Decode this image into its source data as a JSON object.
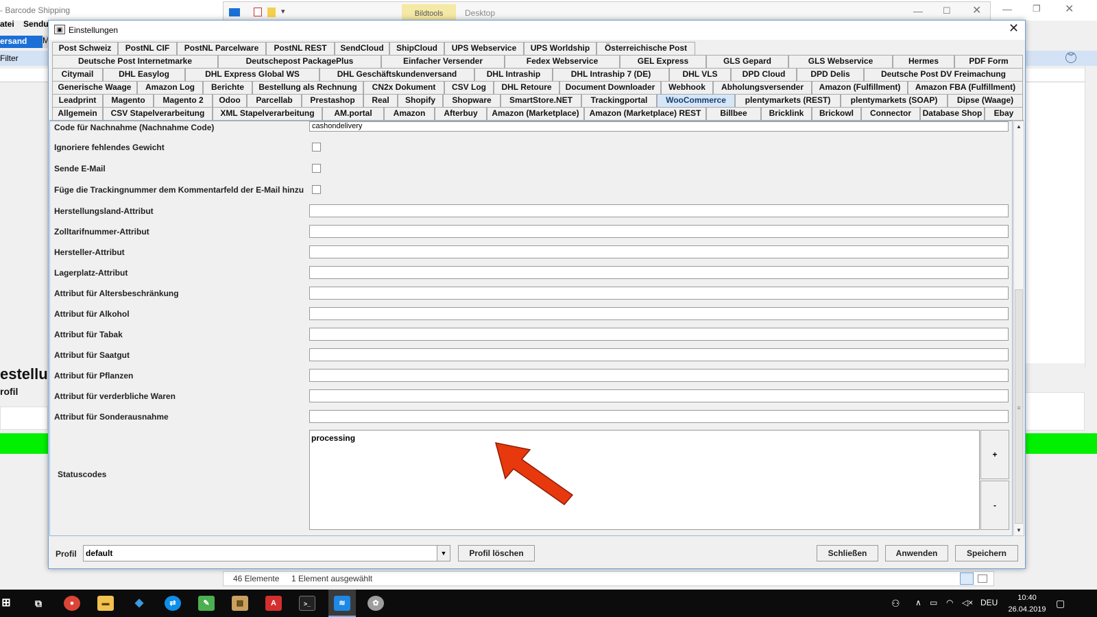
{
  "background_app": {
    "title": "- Barcode Shipping",
    "menu": [
      "atei",
      "Sendu"
    ],
    "active_tab": "ersand",
    "second_tab": "M",
    "filter_label": "Filter",
    "section_title": "estellu",
    "section_sub": "rofil"
  },
  "explorer": {
    "bildtools": "Bildtools",
    "desktop": "Desktop",
    "count": "46 Elemente",
    "selected": "1 Element ausgewählt"
  },
  "dialog": {
    "title": "Einstellungen",
    "tab_rows": [
      [
        "Post Schweiz",
        "PostNL CIF",
        "PostNL Parcelware",
        "PostNL REST",
        "SendCloud",
        "ShipCloud",
        "UPS Webservice",
        "UPS Worldship",
        "Österreichische Post"
      ],
      [
        "Deutsche Post Internetmarke",
        "Deutschepost PackagePlus",
        "Einfacher Versender",
        "Fedex Webservice",
        "GEL Express",
        "GLS Gepard",
        "GLS Webservice",
        "Hermes",
        "PDF Form"
      ],
      [
        "Citymail",
        "DHL Easylog",
        "DHL Express Global WS",
        "DHL Geschäftskundenversand",
        "DHL Intraship",
        "DHL Intraship 7 (DE)",
        "DHL VLS",
        "DPD Cloud",
        "DPD Delis",
        "Deutsche Post DV Freimachung"
      ],
      [
        "Generische Waage",
        "Amazon Log",
        "Berichte",
        "Bestellung als Rechnung",
        "CN2x Dokument",
        "CSV Log",
        "DHL Retoure",
        "Document Downloader",
        "Webhook",
        "Abholungsversender",
        "Amazon (Fulfillment)",
        "Amazon FBA (Fulfillment)"
      ],
      [
        "Leadprint",
        "Magento",
        "Magento 2",
        "Odoo",
        "Parcellab",
        "Prestashop",
        "Real",
        "Shopify",
        "Shopware",
        "SmartStore.NET",
        "Trackingportal",
        "WooCommerce",
        "plentymarkets (REST)",
        "plentymarkets (SOAP)",
        "Dipse (Waage)"
      ],
      [
        "Allgemein",
        "CSV Stapelverarbeitung",
        "XML Stapelverarbeitung",
        "AM.portal",
        "Amazon",
        "Afterbuy",
        "Amazon (Marketplace)",
        "Amazon (Marketplace) REST",
        "Billbee",
        "Bricklink",
        "Brickowl",
        "Connector",
        "Database Shop",
        "Ebay"
      ]
    ],
    "active_tab": "WooCommerce",
    "fields": {
      "nachnahme_label": "Code für Nachnahme (Nachnahme Code)",
      "nachnahme_value": "cashondelivery",
      "ignore_weight": "Ignoriere fehlendes Gewicht",
      "send_email": "Sende E-Mail",
      "tracking_comment": "Füge die Trackingnummer dem Kommentarfeld der E-Mail hinzu",
      "attrs": [
        "Herstellungsland-Attribut",
        "Zolltarifnummer-Attribut",
        "Hersteller-Attribut",
        "Lagerplatz-Attribut",
        "Attribut für Altersbeschränkung",
        "Attribut für Alkohol",
        "Attribut für Tabak",
        "Attribut für Saatgut",
        "Attribut für Pflanzen",
        "Attribut für verderbliche Waren",
        "Attribut für Sonderausnahme"
      ],
      "statuscodes_label": "Statuscodes",
      "statuscodes_value": "processing",
      "plus": "+",
      "minus": "-"
    },
    "bottom": {
      "profil_label": "Profil",
      "profil_value": "default",
      "delete_profile": "Profil löschen",
      "close": "Schließen",
      "apply": "Anwenden",
      "save": "Speichern"
    }
  },
  "taskbar": {
    "language": "DEU",
    "time": "10:40",
    "date": "26.04.2019"
  },
  "colors": {
    "annotation_arrow": "#e8380d",
    "active_tab_bg": "#d5e6f8",
    "highlight_green": "#00f000"
  }
}
